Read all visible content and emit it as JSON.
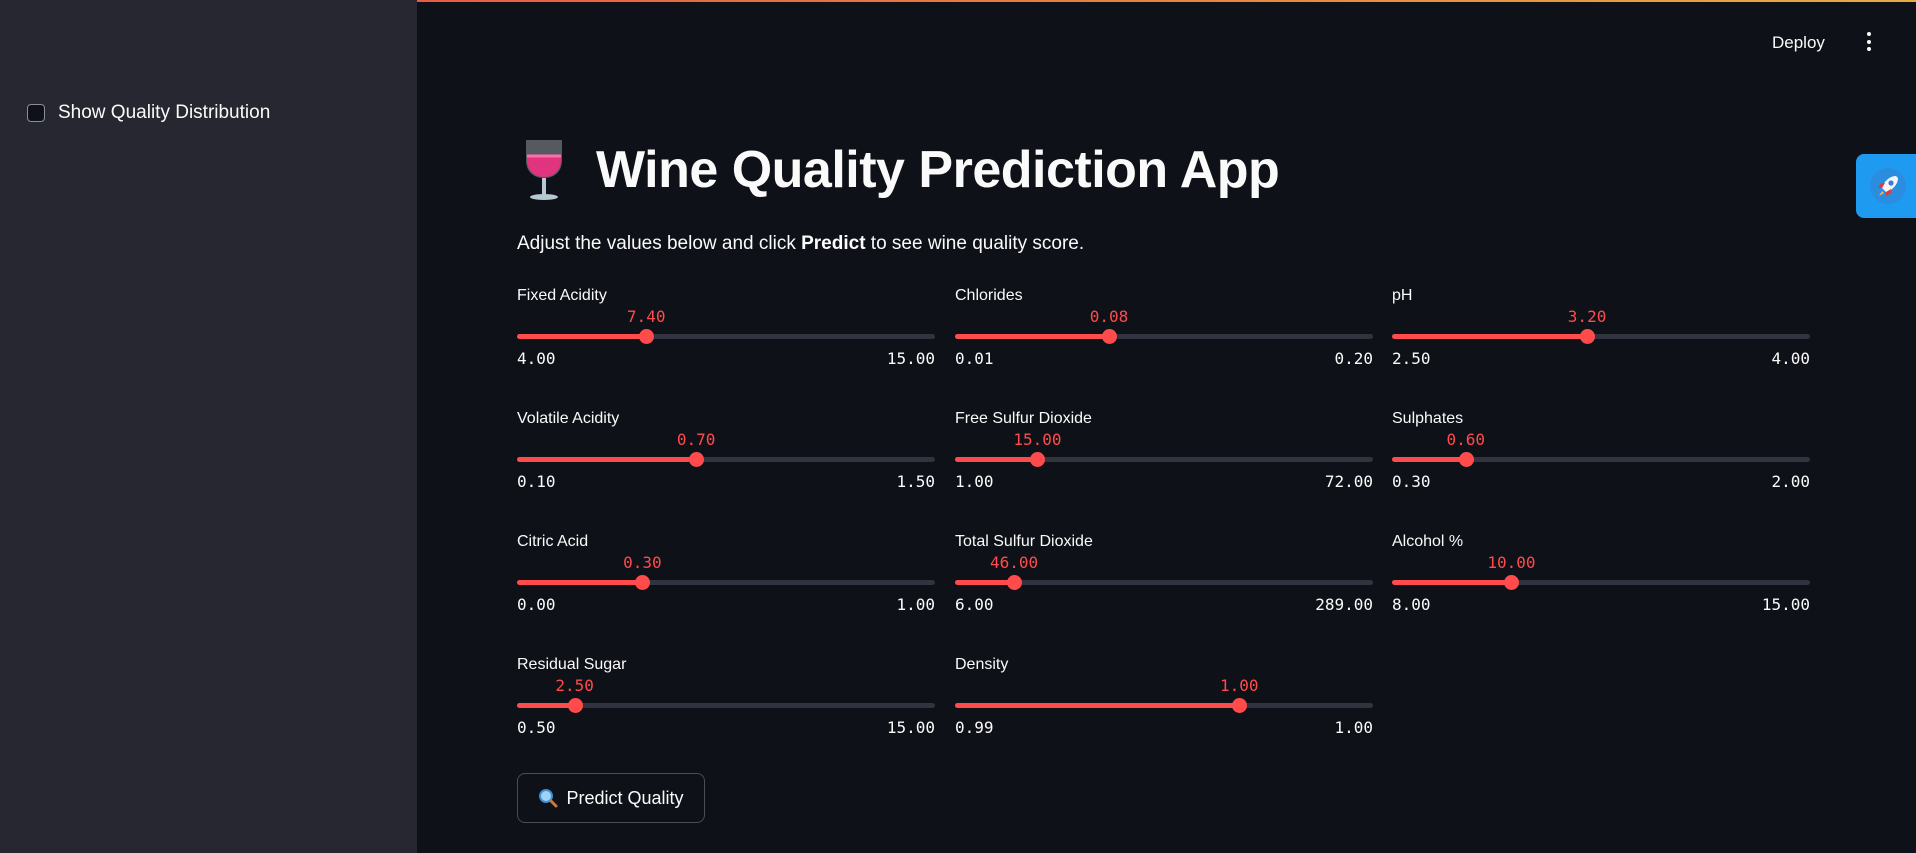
{
  "sidebar": {
    "checkbox_label": "Show Quality Distribution"
  },
  "header": {
    "deploy_label": "Deploy",
    "menu_icon": "kebab-menu-icon"
  },
  "floating": {
    "icon": "rocket-icon"
  },
  "main": {
    "title_icon": "wine-glass-icon",
    "title": "Wine Quality Prediction App",
    "subtitle_before": "Adjust the values below and click ",
    "subtitle_bold": "Predict",
    "subtitle_after": " to see wine quality score.",
    "predict_button_icon": "magnifier-icon",
    "predict_button_label": "Predict Quality"
  },
  "colors": {
    "accent": "#ff4b4b",
    "background": "#0e1117",
    "sidebar": "#262730",
    "track": "#31333f",
    "rocket_badge": "#1e9bf0"
  },
  "sliders": [
    {
      "label": "Fixed Acidity",
      "value": "7.40",
      "min": "4.00",
      "max": "15.00",
      "v": 7.4,
      "lo": 4.0,
      "hi": 15.0
    },
    {
      "label": "Volatile Acidity",
      "value": "0.70",
      "min": "0.10",
      "max": "1.50",
      "v": 0.7,
      "lo": 0.1,
      "hi": 1.5
    },
    {
      "label": "Citric Acid",
      "value": "0.30",
      "min": "0.00",
      "max": "1.00",
      "v": 0.3,
      "lo": 0.0,
      "hi": 1.0
    },
    {
      "label": "Residual Sugar",
      "value": "2.50",
      "min": "0.50",
      "max": "15.00",
      "v": 2.5,
      "lo": 0.5,
      "hi": 15.0
    },
    {
      "label": "Chlorides",
      "value": "0.08",
      "min": "0.01",
      "max": "0.20",
      "v": 0.08,
      "lo": 0.01,
      "hi": 0.2
    },
    {
      "label": "Free Sulfur Dioxide",
      "value": "15.00",
      "min": "1.00",
      "max": "72.00",
      "v": 15.0,
      "lo": 1.0,
      "hi": 72.0
    },
    {
      "label": "Total Sulfur Dioxide",
      "value": "46.00",
      "min": "6.00",
      "max": "289.00",
      "v": 46.0,
      "lo": 6.0,
      "hi": 289.0
    },
    {
      "label": "Density",
      "value": "1.00",
      "min": "0.99",
      "max": "1.00",
      "v": 0.9968,
      "lo": 0.99,
      "hi": 1.0
    },
    {
      "label": "pH",
      "value": "3.20",
      "min": "2.50",
      "max": "4.00",
      "v": 3.2,
      "lo": 2.5,
      "hi": 4.0
    },
    {
      "label": "Sulphates",
      "value": "0.60",
      "min": "0.30",
      "max": "2.00",
      "v": 0.6,
      "lo": 0.3,
      "hi": 2.0
    },
    {
      "label": "Alcohol %",
      "value": "10.00",
      "min": "8.00",
      "max": "15.00",
      "v": 10.0,
      "lo": 8.0,
      "hi": 15.0
    }
  ]
}
